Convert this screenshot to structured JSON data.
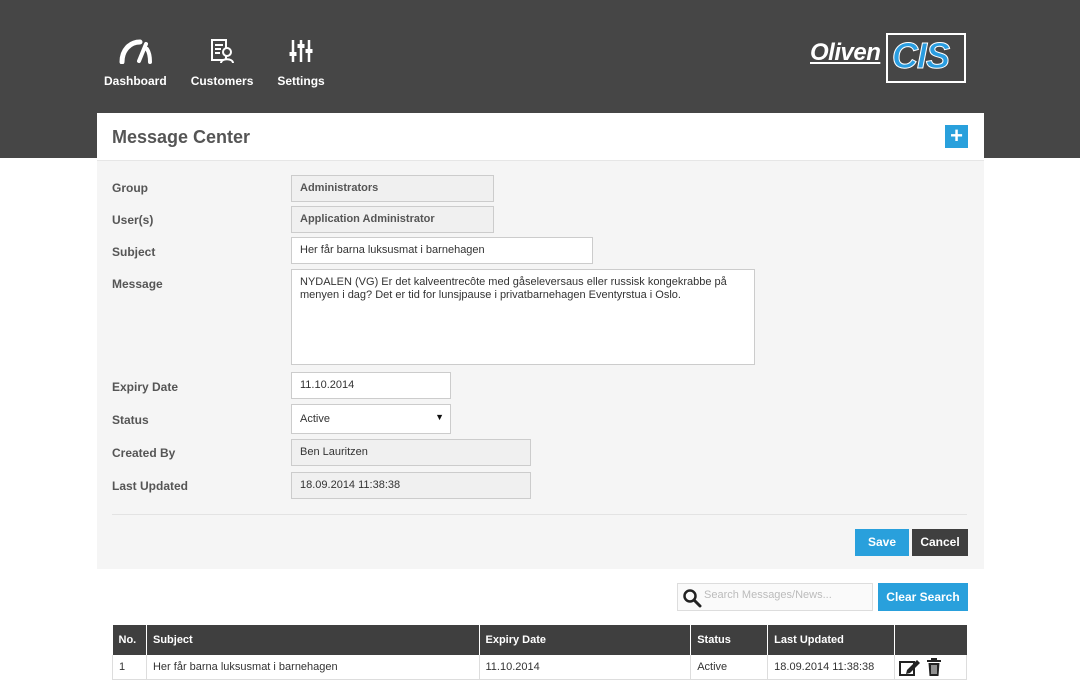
{
  "nav": {
    "items": [
      {
        "label": "Dashboard",
        "icon": "dashboard-gauge-icon"
      },
      {
        "label": "Customers",
        "icon": "customers-icon"
      },
      {
        "label": "Settings",
        "icon": "settings-sliders-icon"
      }
    ]
  },
  "logo": {
    "part1": "Oliven",
    "part2": "CIS"
  },
  "panel": {
    "title": "Message Center",
    "add_label": "+"
  },
  "form": {
    "group_label": "Group",
    "group_value": "Administrators",
    "users_label": "User(s)",
    "users_value": "Application Administrator",
    "subject_label": "Subject",
    "subject_value": "Her får barna luksusmat i barnehagen",
    "message_label": "Message",
    "message_value": "NYDALEN (VG) Er det kalveentrecôte med gåseleversaus eller russisk kongekrabbe på menyen i dag? Det er tid for lunsjpause i privatbarnehagen Eventyrstua i Oslo.",
    "expiry_label": "Expiry Date",
    "expiry_value": "11.10.2014",
    "status_label": "Status",
    "status_value": "Active",
    "created_label": "Created By",
    "created_value": "Ben Lauritzen",
    "updated_label": "Last Updated",
    "updated_value": "18.09.2014 11:38:38"
  },
  "actions": {
    "save": "Save",
    "cancel": "Cancel"
  },
  "search": {
    "placeholder": "Search Messages/News...",
    "clear": "Clear Search"
  },
  "table": {
    "headers": [
      "No.",
      "Subject",
      "Expiry Date",
      "Status",
      "Last Updated",
      ""
    ],
    "rows": [
      {
        "no": "1",
        "subject": "Her får barna luksusmat i barnehagen",
        "expiry": "11.10.2014",
        "status": "Active",
        "updated": "18.09.2014 11:38:38"
      }
    ]
  },
  "colors": {
    "accent": "#29a0dc",
    "topbar": "#464646",
    "dark_button": "#3f3f3f"
  }
}
